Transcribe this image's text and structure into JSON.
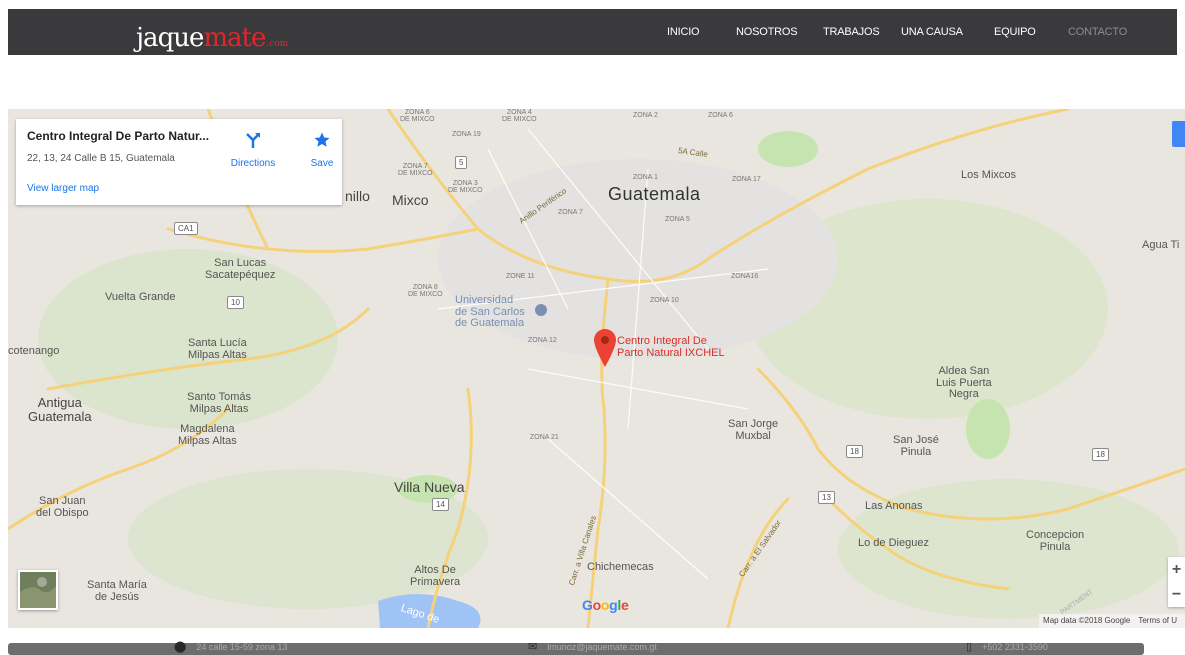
{
  "header": {
    "logo": {
      "main": "jaque",
      "accent": "mate",
      "suffix": ".com"
    },
    "nav": [
      {
        "label": "INICIO"
      },
      {
        "label": "NOSOTROS"
      },
      {
        "label": "TRABAJOS"
      },
      {
        "label": "UNA CAUSA"
      },
      {
        "label": "EQUIPO"
      },
      {
        "label": "CONTACTO"
      }
    ],
    "active_nav": "CONTACTO"
  },
  "map": {
    "place": {
      "name": "Centro Integral De Parto Natur...",
      "address": "22, 13, 24 Calle B 15, Guatemala",
      "directions_label": "Directions",
      "save_label": "Save",
      "larger_map_label": "View larger map"
    },
    "marker_label": [
      "Centro Integral De",
      "Parto Natural IXCHEL"
    ],
    "labels": {
      "guatemala": "Guatemala",
      "mixco": "Mixco",
      "nillo": "nillo",
      "villa_nueva": "Villa Nueva",
      "los_mixcos": "Los Mixcos",
      "agua_ti": "Agua Ti",
      "san_lucas": [
        "San Lucas",
        "Sacatepéquez"
      ],
      "vuelta_grande": "Vuelta Grande",
      "santa_lucia": [
        "Santa Lucía",
        "Milpas Altas"
      ],
      "cotenango": "cotenango",
      "santo_tomas": [
        "Santo Tomás",
        "Milpas Altas"
      ],
      "antigua": [
        "Antigua",
        "Guatemala"
      ],
      "magdalena": [
        "Magdalena",
        "Milpas Altas"
      ],
      "san_juan": [
        "San Juan",
        "del Obispo"
      ],
      "santa_maria": [
        "Santa María",
        "de Jesús"
      ],
      "altos": [
        "Altos De",
        "Primavera"
      ],
      "lago": "Lago de",
      "chichemecas": "Chichemecas",
      "san_jorge": [
        "San Jorge",
        "Muxbal"
      ],
      "san_jose": [
        "San José",
        "Pinula"
      ],
      "las_anonas": "Las Anonas",
      "lo_de_dieguez": "Lo de Dieguez",
      "concepcion": [
        "Concepcion",
        "Pinula"
      ],
      "aldea": [
        "Aldea San",
        "Luis Puerta",
        "Negra"
      ],
      "universidad": [
        "Universidad",
        "de San Carlos",
        "de Guatemala"
      ],
      "apartment": "PARTMENT",
      "zones": {
        "z6mixco": [
          "ZONA 6",
          "DE MIXCO"
        ],
        "z4mixco": [
          "ZONA 4",
          "DE MIXCO"
        ],
        "z19": "ZONA 19",
        "z2": "ZONA 2",
        "z6": "ZONA 6",
        "z7mixco": [
          "ZONA 7",
          "DE MIXCO"
        ],
        "z3mixco": [
          "ZONA 3",
          "DE MIXCO"
        ],
        "z1": "ZONA 1",
        "z17": "ZONA 17",
        "z7": "ZONA 7",
        "z5": "ZONA 5",
        "z11": "ZONE 11",
        "z8mixco": [
          "ZONA 8",
          "DE MIXCO"
        ],
        "z16": "ZONA16",
        "z10": "ZONA 10",
        "z12": "ZONA 12",
        "z21": "ZONA 21"
      },
      "roads": {
        "sa_calle": "5A Calle",
        "periferico": "Anillo Periférico",
        "villa_canales": "Carr. a Villa Canales",
        "el_salvador": "Carr. a El Salvador"
      },
      "shields": [
        "5",
        "CA1",
        "10",
        "14",
        "18",
        "13",
        "18"
      ]
    },
    "google_logo": "Google",
    "attribution": {
      "data": "Map data ©2018 Google",
      "terms": "Terms of U"
    },
    "zoom": {
      "in": "+",
      "out": "−"
    }
  },
  "footer": {
    "address": "24 calle 15-59 zona 13",
    "email": "lmunoz@jaquemate.com.gt",
    "phone": "+502 2331-3590"
  },
  "colors": {
    "navbar": "#3a3a3c",
    "accent": "#e2252b",
    "link": "#1a73e8",
    "road": "#f5d27a",
    "park": "#c6e4b0"
  }
}
